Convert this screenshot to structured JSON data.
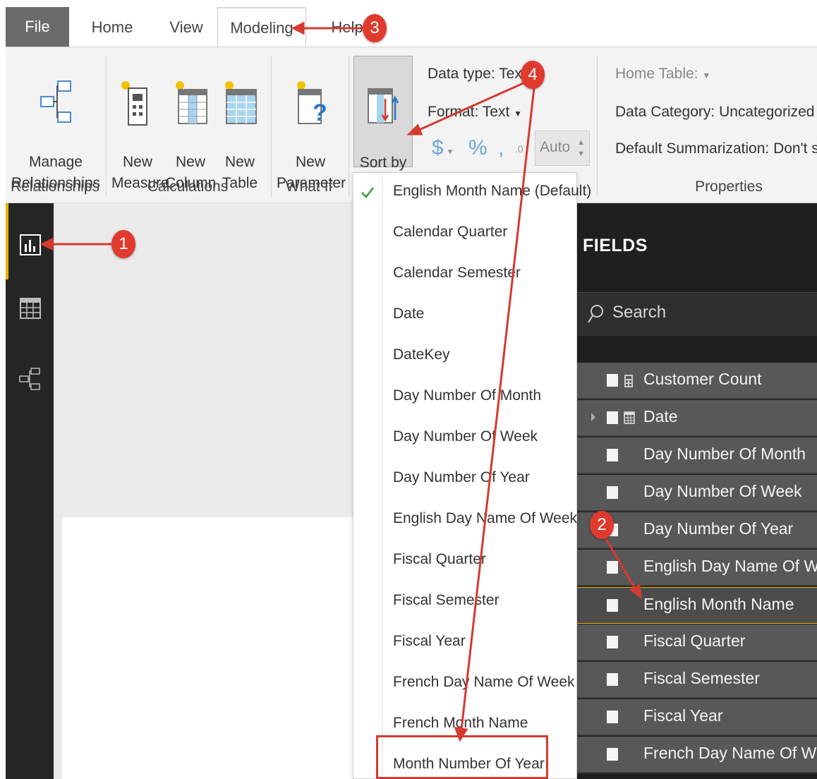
{
  "tabs": [
    {
      "label": "File"
    },
    {
      "label": "Home"
    },
    {
      "label": "View"
    },
    {
      "label": "Modeling"
    },
    {
      "label": "Help"
    }
  ],
  "ribbon": {
    "manage_relationships": "Manage\nRelationships",
    "new_measure": "New\nMeasure",
    "new_column": "New\nColumn",
    "new_table": "New\nTable",
    "new_parameter": "New\nParameter",
    "sort_by_column": "Sort by\nColumn",
    "groups": {
      "relationships": "Relationships",
      "calculations": "Calculations",
      "what_if": "What If",
      "properties": "Properties"
    },
    "data_type": "Data type: Text",
    "format": "Format: Text",
    "currency": "$",
    "percent": "%",
    "comma": ",",
    "decimal": ".0",
    "auto": "Auto",
    "home_table": "Home Table:",
    "data_category": "Data Category: Uncategorized",
    "default_summarization": "Default Summarization: Don't sum"
  },
  "sort_menu": {
    "items": [
      "English Month Name (Default)",
      "Calendar Quarter",
      "Calendar Semester",
      "Date",
      "DateKey",
      "Day Number Of Month",
      "Day Number Of Week",
      "Day Number Of Year",
      "English Day Name Of Week",
      "Fiscal Quarter",
      "Fiscal Semester",
      "Fiscal Year",
      "French Day Name Of Week",
      "French Month Name",
      "Month Number Of Year"
    ],
    "checked_index": 0
  },
  "fields_pane": {
    "title": "FIELDS",
    "search_placeholder": "Search",
    "rows": [
      {
        "label": "Customer Count",
        "icon": "calculator-icon"
      },
      {
        "label": "Date",
        "icon": "table-icon",
        "expandable": true
      },
      {
        "label": "Day Number Of Month"
      },
      {
        "label": "Day Number Of Week"
      },
      {
        "label": "Day Number Of Year"
      },
      {
        "label": "English Day Name Of Week"
      },
      {
        "label": "English Month Name",
        "selected": true
      },
      {
        "label": "Fiscal Quarter"
      },
      {
        "label": "Fiscal Semester"
      },
      {
        "label": "Fiscal Year"
      },
      {
        "label": "French Day Name Of Week"
      }
    ]
  },
  "annotations": [
    "1",
    "2",
    "3",
    "4"
  ],
  "colors": {
    "accent": "#e8b400",
    "annotation": "#e03a2e",
    "fields_bg": "#1f1f1f",
    "field_row": "#585858"
  }
}
